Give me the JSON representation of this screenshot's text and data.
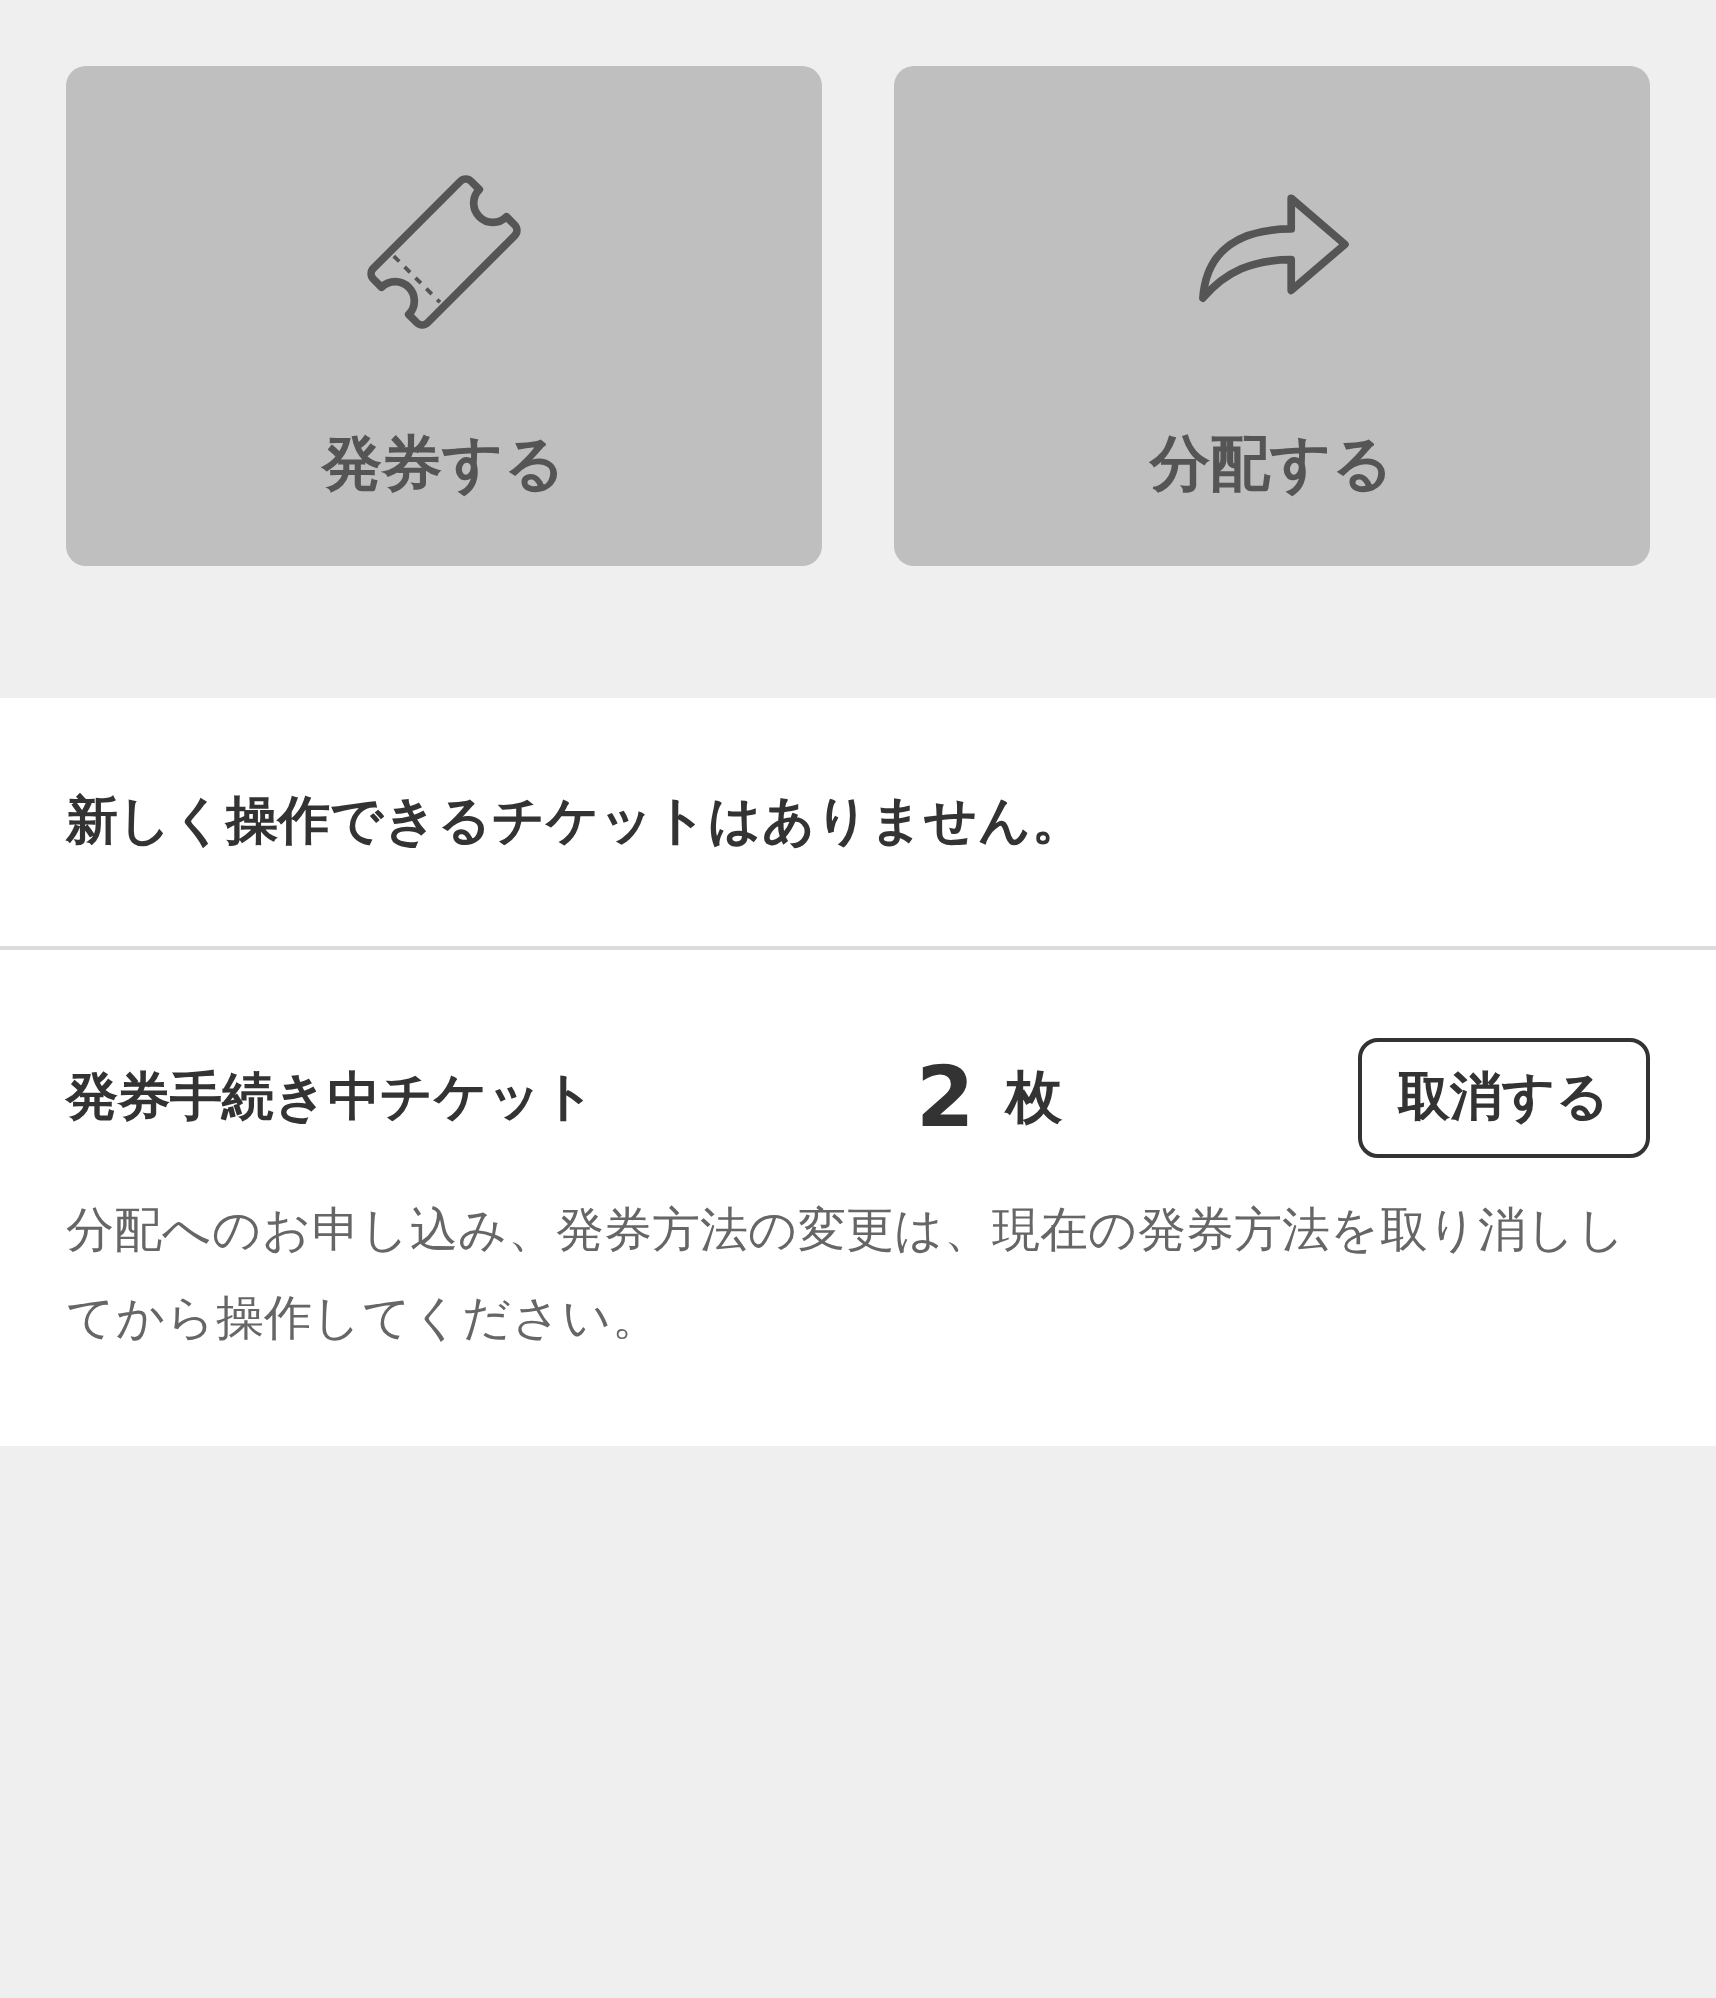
{
  "action_buttons": [
    {
      "kind": "ticket",
      "label": "発券する",
      "disabled": true
    },
    {
      "kind": "share",
      "label": "分配する",
      "disabled": true
    }
  ],
  "message": "新しく操作できるチケットはありません。",
  "pending": {
    "label": "発券手続き中チケット",
    "count": "2",
    "unit": "枚",
    "cancel_button": "取消する",
    "note": "分配へのお申し込み、発券方法の変更は、現在の発券方法を取り消ししてから操作してください。"
  }
}
